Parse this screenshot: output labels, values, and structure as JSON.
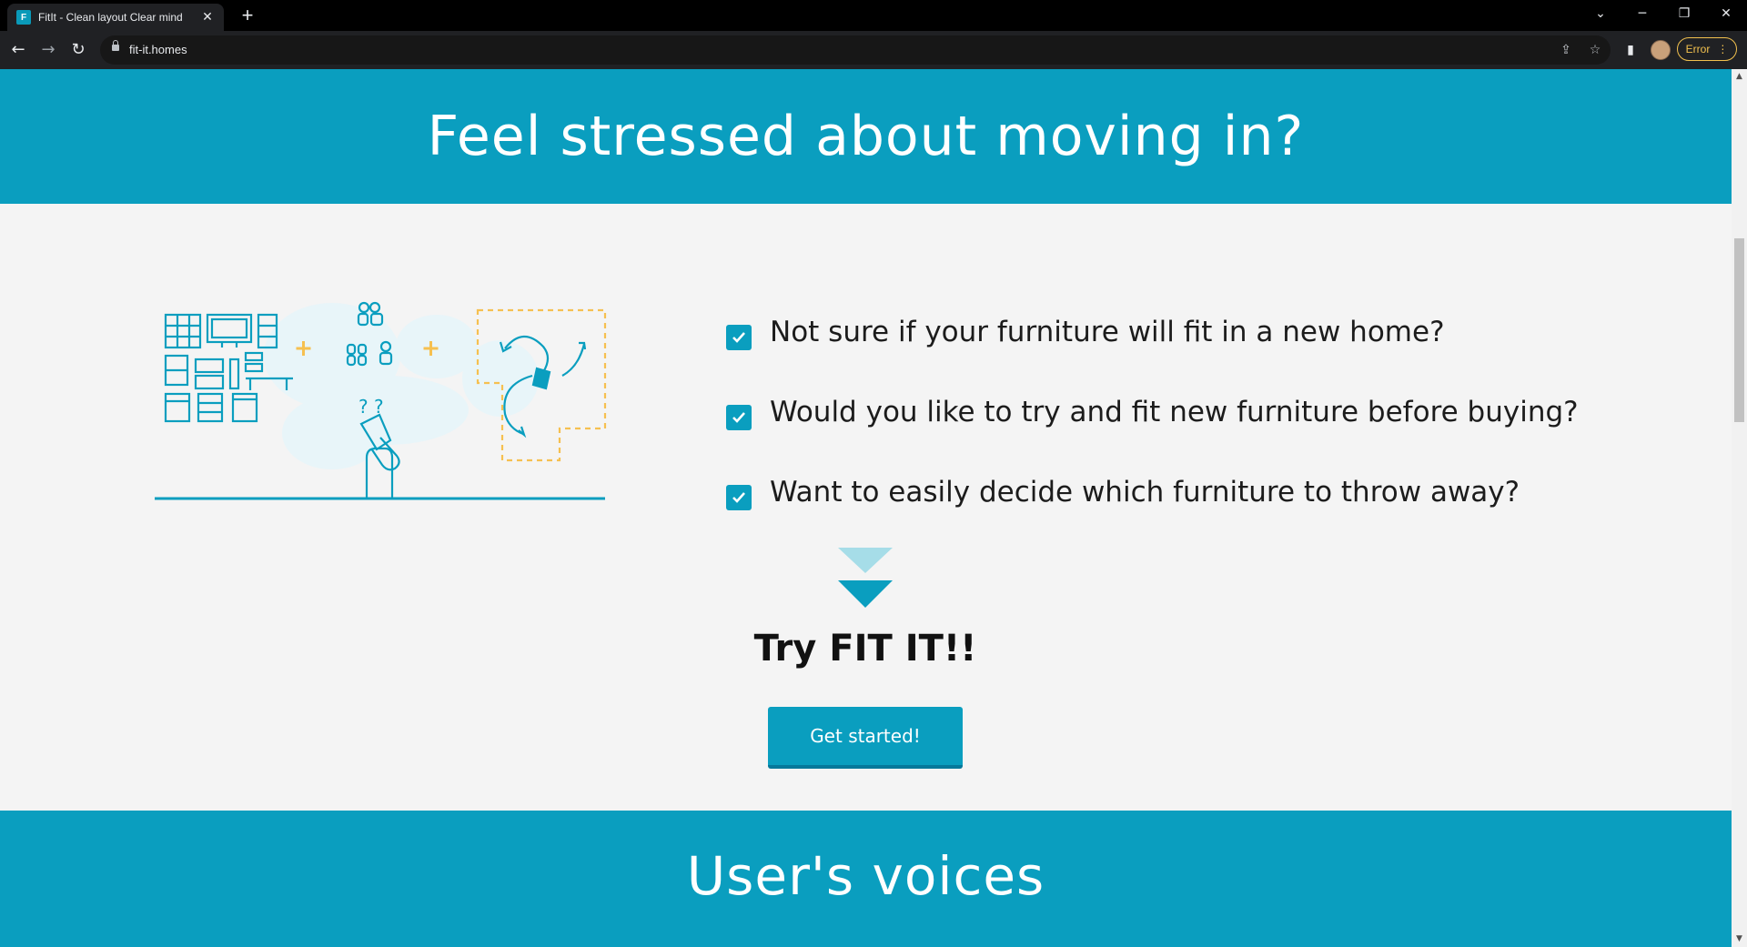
{
  "browser": {
    "tab_title": "FitIt - Clean layout Clear mind",
    "favicon_letter": "F",
    "url": "fit-it.homes",
    "profile_error": "Error"
  },
  "page": {
    "hero_title": "Feel stressed about moving in?",
    "questions": [
      "Not sure if your furniture will fit in a new home?",
      "Would you like to try and fit new furniture before buying?",
      "Want to easily decide which furniture to throw away?"
    ],
    "cta_title": "Try FIT IT!!",
    "cta_button": "Get started!",
    "section_title": "User's voices"
  },
  "colors": {
    "accent": "#0a9ebf",
    "accent_light": "#a6dde8",
    "highlight": "#f6c050",
    "background": "#f4f4f4"
  },
  "icons": {
    "checkbox": "checkmark-icon",
    "arrow": "chevron-down-icon"
  }
}
